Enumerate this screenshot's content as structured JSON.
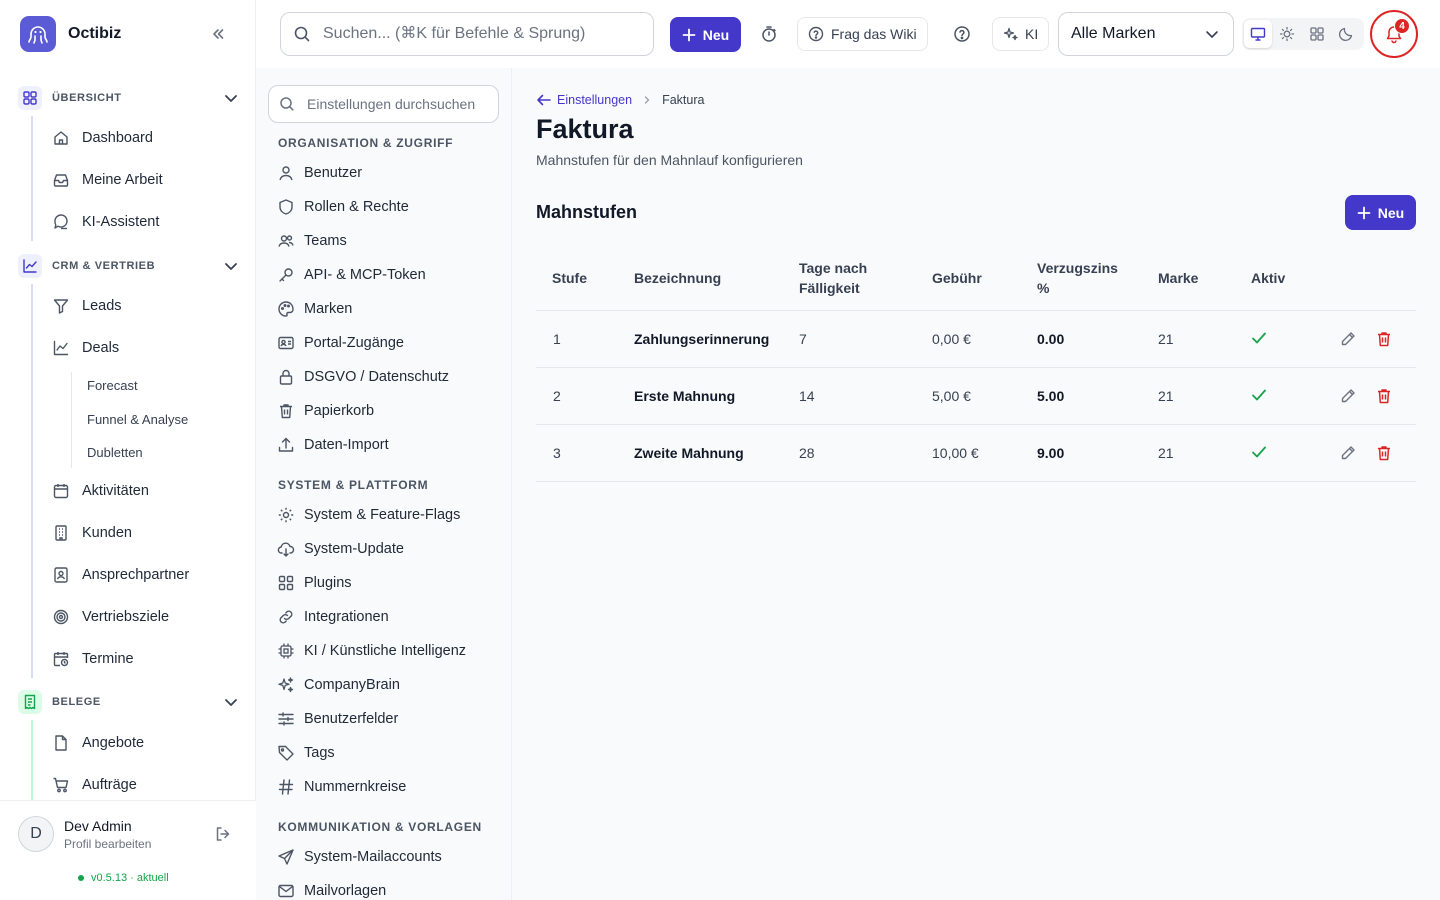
{
  "app": {
    "name": "Octibiz"
  },
  "colors": {
    "accent": "#4338ca",
    "danger": "#dc2626",
    "success": "#16a34a"
  },
  "topbar": {
    "search_placeholder": "Suchen... (⌘K für Befehle & Sprung)",
    "new_label": "Neu",
    "wiki_label": "Frag das Wiki",
    "ai_label": "KI",
    "brand_select_value": "Alle Marken",
    "notification_count": "4"
  },
  "sidebar": {
    "groups": [
      {
        "title": "ÜBERSICHT",
        "items": [
          "Dashboard",
          "Meine Arbeit",
          "KI-Assistent"
        ]
      },
      {
        "title": "CRM & VERTRIEB",
        "items": [
          "Leads",
          "Deals",
          "Aktivitäten",
          "Kunden",
          "Ansprechpartner",
          "Vertriebsziele",
          "Termine"
        ],
        "subitems": [
          "Forecast",
          "Funnel & Analyse",
          "Dubletten"
        ]
      },
      {
        "title": "BELEGE",
        "items": [
          "Angebote",
          "Aufträge"
        ]
      }
    ],
    "user": {
      "name": "Dev Admin",
      "initial": "D",
      "sub": "Profil bearbeiten"
    },
    "version": "v0.5.13 · aktuell"
  },
  "settings": {
    "search_placeholder": "Einstellungen durchsuchen",
    "sections": [
      {
        "title": "ORGANISATION & ZUGRIFF",
        "items": [
          "Benutzer",
          "Rollen & Rechte",
          "Teams",
          "API- & MCP-Token",
          "Marken",
          "Portal-Zugänge",
          "DSGVO / Datenschutz",
          "Papierkorb",
          "Daten-Import"
        ]
      },
      {
        "title": "SYSTEM & PLATTFORM",
        "items": [
          "System & Feature-Flags",
          "System-Update",
          "Plugins",
          "Integrationen",
          "KI / Künstliche Intelligenz",
          "CompanyBrain",
          "Benutzerfelder",
          "Tags",
          "Nummernkreise"
        ]
      },
      {
        "title": "KOMMUNIKATION & VORLAGEN",
        "items": [
          "System-Mailaccounts",
          "Mailvorlagen"
        ]
      }
    ]
  },
  "main": {
    "breadcrumb": {
      "back": "Einstellungen",
      "current": "Faktura"
    },
    "title": "Faktura",
    "subtitle": "Mahnstufen für den Mahnlauf konfigurieren",
    "section_title": "Mahnstufen",
    "new_label": "Neu",
    "table": {
      "headers": {
        "stufe": "Stufe",
        "bezeichnung": "Bezeichnung",
        "tage": "Tage nach Fälligkeit",
        "gebuehr": "Gebühr",
        "zins": "Verzugszins %",
        "marke": "Marke",
        "aktiv": "Aktiv"
      },
      "rows": [
        {
          "stufe": "1",
          "bezeichnung": "Zahlungserinnerung",
          "tage": "7",
          "gebuehr": "0,00 €",
          "zins": "0.00",
          "marke": "21",
          "aktiv": true
        },
        {
          "stufe": "2",
          "bezeichnung": "Erste Mahnung",
          "tage": "14",
          "gebuehr": "5,00 €",
          "zins": "5.00",
          "marke": "21",
          "aktiv": true
        },
        {
          "stufe": "3",
          "bezeichnung": "Zweite Mahnung",
          "tage": "28",
          "gebuehr": "10,00 €",
          "zins": "9.00",
          "marke": "21",
          "aktiv": true
        }
      ]
    }
  }
}
